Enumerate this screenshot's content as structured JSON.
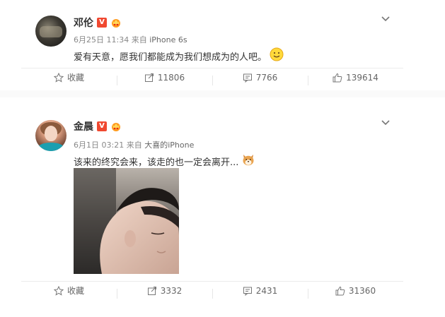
{
  "posts": [
    {
      "name": "邓伦",
      "verified_badge": "V",
      "meta_date": "6月25日 11:34",
      "meta_from": "来自",
      "meta_source": "iPhone 6s",
      "text": "爱有天意，愿我们都能成为我们想成为的人吧。",
      "emoji": "smile-emoji",
      "actions": {
        "favorite_label": "收藏",
        "repost_count": "11806",
        "comment_count": "7766",
        "like_count": "139614"
      }
    },
    {
      "name": "金晨",
      "verified_badge": "V",
      "meta_date": "6月1日 03:21",
      "meta_from": "来自",
      "meta_source": "大喜的iPhone",
      "text": "该来的终究会来，该走的也一定会离开...",
      "emoji": "shiba-dog-emoji",
      "actions": {
        "favorite_label": "收藏",
        "repost_count": "3332",
        "comment_count": "2431",
        "like_count": "31360"
      }
    }
  ],
  "colors": {
    "verified_badge": "#f04830",
    "text": "#333333",
    "meta": "#888888"
  }
}
